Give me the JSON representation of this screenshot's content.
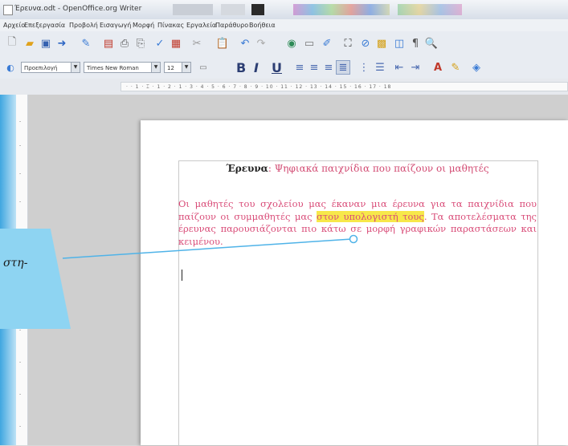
{
  "window": {
    "title": "Έρευνα.odt - OpenOffice.org Writer"
  },
  "menubar": {
    "items": [
      "Αρχείο",
      "Επεξεργασία",
      "Προβολή",
      "Εισαγωγή",
      "Μορφή",
      "Πίνακας",
      "Εργαλεία",
      "Παράθυρο",
      "Βοήθεια"
    ]
  },
  "toolbar_format": {
    "style": "Προεπιλογή",
    "font": "Times New Roman",
    "size": "12",
    "bold": "B",
    "italic": "I",
    "underline": "U"
  },
  "ruler": {
    "marks": "· · 1 · ⌶ · 1 · 2 · 1 · 3 · 4 · 5 · 6 · 7 · 8 · 9 · 10 · 11 · 12 · 13 · 14 · 15 · 16 · 17 · 18"
  },
  "document": {
    "heading_bold": "Έρευνα",
    "heading_rest": ": Ψηφιακά παιχνίδια που παίζουν οι μαθητές",
    "para_before": "Οι μαθητές του σχολείου μας έκαναν μια έρευνα για τα παιχνίδια που παίζουν οι συμμαθητές μας ",
    "para_highlight": "στον υπολογιστή τους",
    "para_after": ". Τα αποτελέσματα της έρευνας παρουσιάζονται πιο κάτω σε μορφή γραφικών παραστάσεων και κειμένου."
  },
  "callout": {
    "text": "στη-"
  },
  "colors": {
    "callout_bg": "#8ed4f2",
    "text_pink": "#d94c78",
    "highlight": "#f7e84a"
  }
}
